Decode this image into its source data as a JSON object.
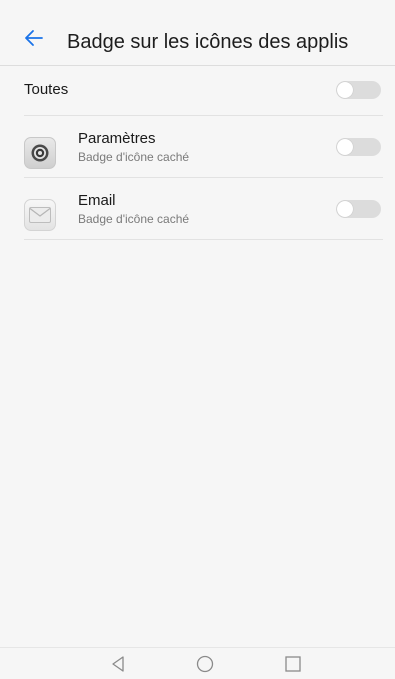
{
  "header": {
    "title": "Badge sur les icônes des applis",
    "back_icon": "arrow-left-icon",
    "accent_color": "#1a73e8"
  },
  "all_row": {
    "label": "Toutes",
    "toggle_on": false
  },
  "apps": [
    {
      "name": "Paramètres",
      "subtitle": "Badge d'icône caché",
      "icon": "settings-icon",
      "toggle_on": false
    },
    {
      "name": "Email",
      "subtitle": "Badge d'icône caché",
      "icon": "email-icon",
      "toggle_on": false
    }
  ],
  "navbar": {
    "back_icon": "nav-back-icon",
    "home_icon": "nav-home-icon",
    "recents_icon": "nav-recents-icon"
  }
}
